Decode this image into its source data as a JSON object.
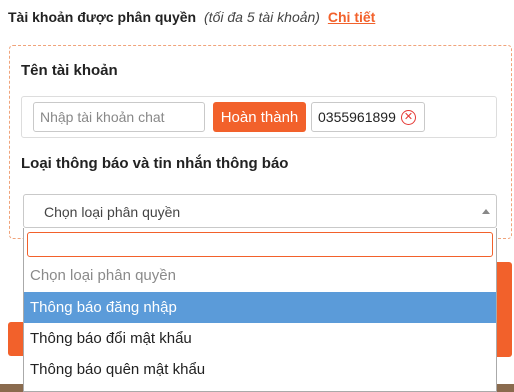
{
  "header": {
    "title": "Tài khoản được phân quyền",
    "note": "(tối đa 5 tài khoản)",
    "link": "Chi tiết"
  },
  "account": {
    "label": "Tên tài khoản",
    "input_placeholder": "Nhập tài khoản chat",
    "done_label": "Hoàn thành",
    "chip_value": "0355961899",
    "chip_remove_icon": "close-circle-icon"
  },
  "notify": {
    "label": "Loại thông báo và tin nhắn thông báo",
    "select_value": "Chọn loại phân quyền"
  },
  "dropdown": {
    "search_value": "",
    "options": [
      {
        "label": "Chọn loại phân quyền",
        "state": "disabled"
      },
      {
        "label": "Thông báo đăng nhập",
        "state": "highlighted"
      },
      {
        "label": "Thông báo đổi mật khẩu",
        "state": "normal"
      },
      {
        "label": "Thông báo quên mật khẩu",
        "state": "normal"
      }
    ]
  },
  "colors": {
    "accent": "#f2612b",
    "highlight": "#5b9bd9",
    "danger": "#e53935"
  }
}
